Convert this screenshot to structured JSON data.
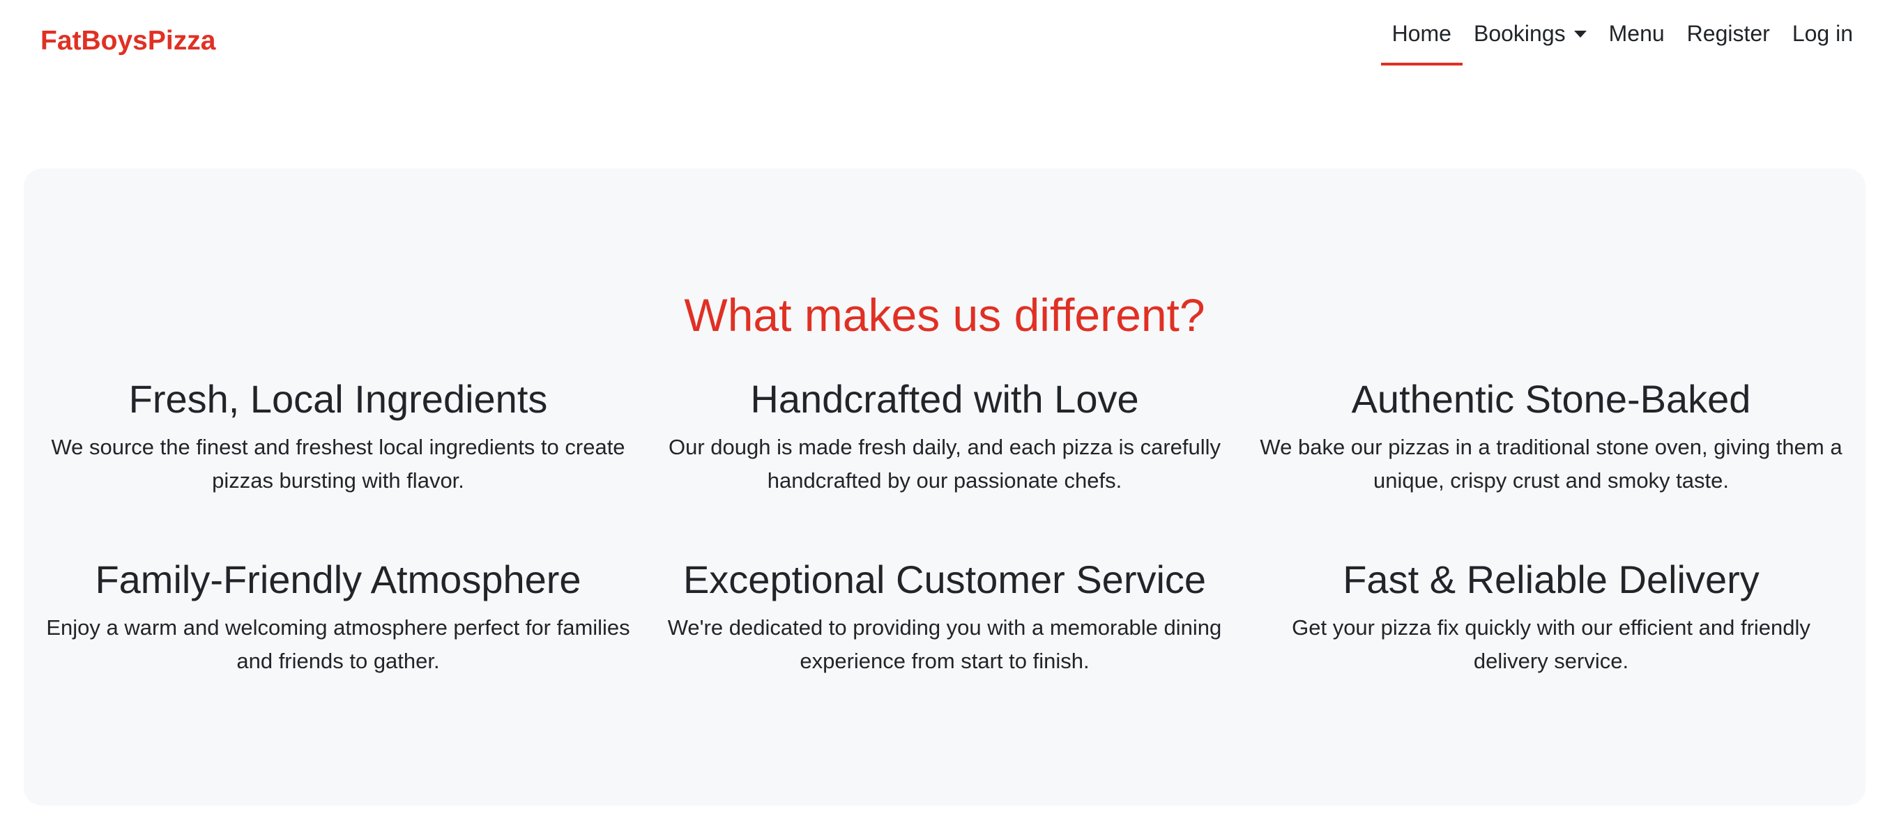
{
  "brand": {
    "name": "FatBoysPizza",
    "color": "#e03024"
  },
  "nav": {
    "items": [
      {
        "label": "Home",
        "active": true
      },
      {
        "label": "Bookings",
        "dropdown": true
      },
      {
        "label": "Menu"
      },
      {
        "label": "Register"
      },
      {
        "label": "Log in"
      }
    ]
  },
  "section": {
    "title": "What makes us different?",
    "features": [
      {
        "title": "Fresh, Local Ingredients",
        "text": "We source the finest and freshest local ingredients to create pizzas bursting with flavor."
      },
      {
        "title": "Handcrafted with Love",
        "text": "Our dough is made fresh daily, and each pizza is carefully handcrafted by our passionate chefs."
      },
      {
        "title": "Authentic Stone-Baked",
        "text": "We bake our pizzas in a traditional stone oven, giving them a unique, crispy crust and smoky taste."
      },
      {
        "title": "Family-Friendly Atmosphere",
        "text": "Enjoy a warm and welcoming atmosphere perfect for families and friends to gather."
      },
      {
        "title": "Exceptional Customer Service",
        "text": "We're dedicated to providing you with a memorable dining experience from start to finish."
      },
      {
        "title": "Fast & Reliable Delivery",
        "text": "Get your pizza fix quickly with our efficient and friendly delivery service."
      }
    ]
  },
  "colors": {
    "accent": "#e03024",
    "panel_background": "#f7f8fa",
    "text": "#212529"
  }
}
